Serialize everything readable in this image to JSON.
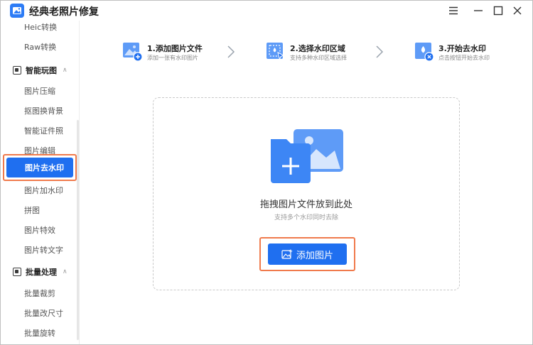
{
  "app": {
    "title": "经典老照片修复"
  },
  "sidebar": {
    "items_top": [
      "Heic转换",
      "Raw转换"
    ],
    "group1": {
      "label": "智能玩图"
    },
    "group1_items": [
      "图片压缩",
      "抠图换背景",
      "智能证件照",
      "图片编辑"
    ],
    "active_item": "图片去水印",
    "group1_items_after": [
      "图片加水印",
      "拼图",
      "图片特效",
      "图片转文字"
    ],
    "group2": {
      "label": "批量处理"
    },
    "group2_items": [
      "批量裁剪",
      "批量改尺寸",
      "批量旋转"
    ]
  },
  "steps": [
    {
      "title": "1.添加图片文件",
      "desc": "添加一张有水印图片"
    },
    {
      "title": "2.选择水印区域",
      "desc": "支持多种水印区域选择"
    },
    {
      "title": "3.开始去水印",
      "desc": "点击按钮开始去水印"
    }
  ],
  "dropzone": {
    "title": "拖拽图片文件放到此处",
    "subtitle": "支持多个水印同时去除",
    "button_label": "添加图片"
  },
  "colors": {
    "accent": "#1f6ff0",
    "highlight": "#f07a4c"
  }
}
